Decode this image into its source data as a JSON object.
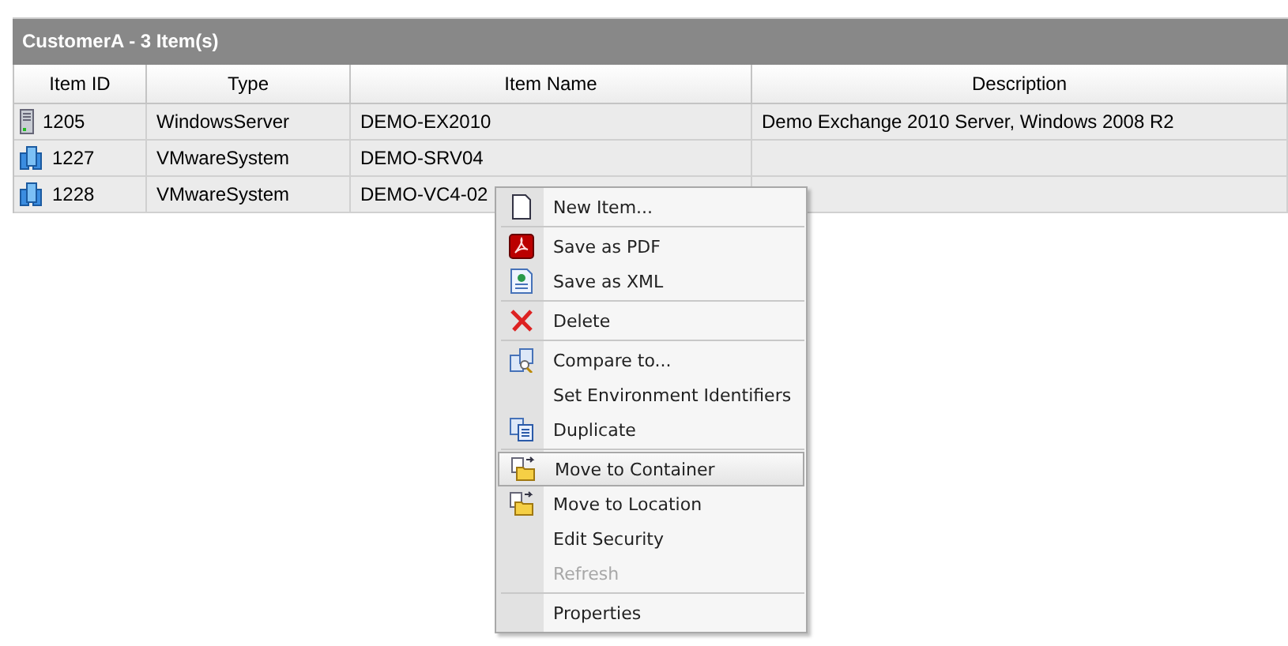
{
  "panel": {
    "title": "CustomerA - 3 Item(s)"
  },
  "table": {
    "columns": [
      "Item ID",
      "Type",
      "Item Name",
      "Description"
    ],
    "rows": [
      {
        "kind": "server",
        "id": "1205",
        "type": "WindowsServer",
        "name": "DEMO-EX2010",
        "description": "Demo Exchange 2010 Server, Windows 2008 R2"
      },
      {
        "kind": "vm",
        "id": "1227",
        "type": "VMwareSystem",
        "name": "DEMO-SRV04"
      },
      {
        "kind": "vm",
        "id": "1228",
        "type": "VMwareSystem",
        "name": "DEMO-VC4-02"
      }
    ]
  },
  "context_menu": {
    "groups": [
      [
        {
          "label": "New Item...",
          "kind": "page",
          "disabled": false,
          "selected": false
        }
      ],
      [
        {
          "label": "Save as PDF",
          "kind": "pdf",
          "disabled": false,
          "selected": false
        },
        {
          "label": "Save as XML",
          "kind": "xml",
          "disabled": false,
          "selected": false
        }
      ],
      [
        {
          "label": "Delete",
          "kind": "cross",
          "disabled": false,
          "selected": false
        }
      ],
      [
        {
          "label": "Compare to...",
          "kind": "compare",
          "disabled": false,
          "selected": false
        },
        {
          "label": "Set Environment Identifiers",
          "kind": "plain",
          "disabled": false,
          "selected": false
        },
        {
          "label": "Duplicate",
          "kind": "copy",
          "disabled": false,
          "selected": false
        }
      ],
      [
        {
          "label": "Move to Container",
          "kind": "move",
          "disabled": false,
          "selected": true
        },
        {
          "label": "Move to Location",
          "kind": "move",
          "disabled": false,
          "selected": false
        },
        {
          "label": "Edit Security",
          "kind": "plain",
          "disabled": false,
          "selected": false
        },
        {
          "label": "Refresh",
          "kind": "plain",
          "disabled": true,
          "selected": false
        }
      ],
      [
        {
          "label": "Properties",
          "kind": "plain",
          "disabled": false,
          "selected": false
        }
      ]
    ]
  }
}
